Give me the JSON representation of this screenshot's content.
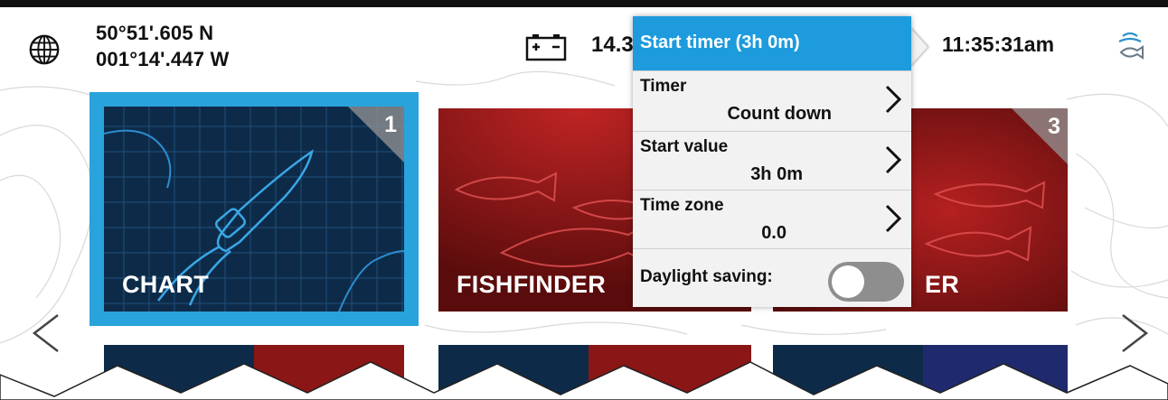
{
  "status_bar": {
    "latitude": "50°51'.605 N",
    "longitude": "001°14'.447 W",
    "voltage": "14.3",
    "time": "11:35:31am"
  },
  "icons": {
    "globe": "globe-icon",
    "battery": "battery-icon",
    "fish_alarm": "fish-icon",
    "nav_left": "chevron-left-icon",
    "nav_right": "chevron-right-icon"
  },
  "tiles": [
    {
      "label": "CHART",
      "number": "1",
      "selected": true
    },
    {
      "label": "FISHFINDER",
      "number": ""
    },
    {
      "label": "ER",
      "number": "3"
    }
  ],
  "popup": {
    "header": "Start timer (3h 0m)",
    "rows": [
      {
        "label": "Timer",
        "value": "Count down"
      },
      {
        "label": "Start value",
        "value": "3h 0m"
      },
      {
        "label": "Time zone",
        "value": "0.0"
      }
    ],
    "toggle_label": "Daylight saving:",
    "toggle_on": false
  },
  "colors": {
    "accent": "#1d9bdd",
    "selection_border": "#29a3dc",
    "chart_tile": "#0d2b49",
    "fishfinder_tile": "#7a1414"
  }
}
